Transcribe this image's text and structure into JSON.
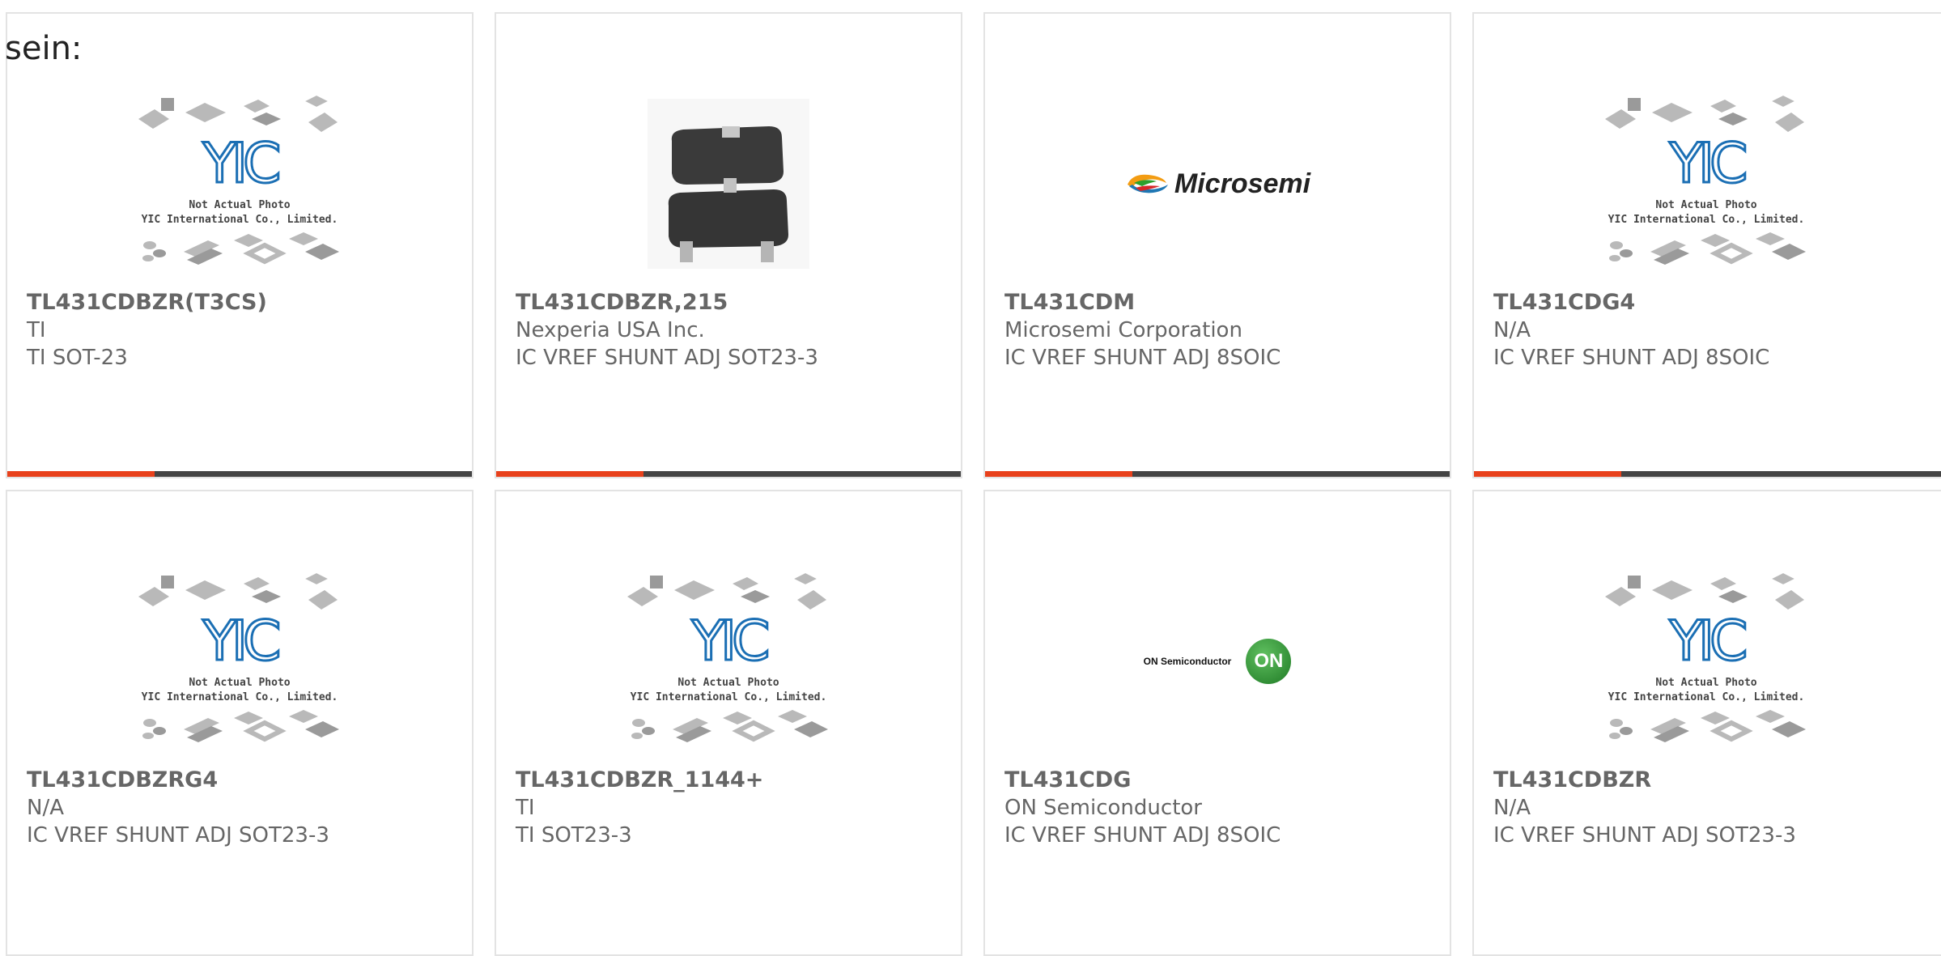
{
  "intro_text": "sein:",
  "colors": {
    "accent": "#e8411c",
    "bar": "#444444",
    "yic_blue": "#1b6fb4",
    "on_green": "#2f8f34"
  },
  "placeholder": {
    "line1": "Not Actual Photo",
    "line2": "YIC International Co., Limited.",
    "logo_text": "YIC"
  },
  "cards": [
    {
      "part": "TL431CDBZR(T3CS)",
      "manufacturer": "TI",
      "description": "TI SOT-23",
      "image": "yic-placeholder"
    },
    {
      "part": "TL431CDBZR,215",
      "manufacturer": "Nexperia USA Inc.",
      "description": "IC VREF SHUNT ADJ SOT23-3",
      "image": "sot23-photo"
    },
    {
      "part": "TL431CDM",
      "manufacturer": "Microsemi Corporation",
      "description": "IC VREF SHUNT ADJ 8SOIC",
      "image": "microsemi-logo",
      "logo_text": "Microsemi"
    },
    {
      "part": "TL431CDG4",
      "manufacturer": "N/A",
      "description": "IC VREF SHUNT ADJ 8SOIC",
      "image": "yic-placeholder"
    },
    {
      "part": "TL431CDBZRG4",
      "manufacturer": "N/A",
      "description": "IC VREF SHUNT ADJ SOT23-3",
      "image": "yic-placeholder"
    },
    {
      "part": "TL431CDBZR_1144+",
      "manufacturer": "TI",
      "description": "TI SOT23-3",
      "image": "yic-placeholder"
    },
    {
      "part": "TL431CDG",
      "manufacturer": "ON Semiconductor",
      "description": "IC VREF SHUNT ADJ 8SOIC",
      "image": "onsemi-logo",
      "logo_text": "ON Semiconductor",
      "logo_mark": "ON"
    },
    {
      "part": "TL431CDBZR",
      "manufacturer": "N/A",
      "description": "IC VREF SHUNT ADJ SOT23-3",
      "image": "yic-placeholder"
    }
  ]
}
